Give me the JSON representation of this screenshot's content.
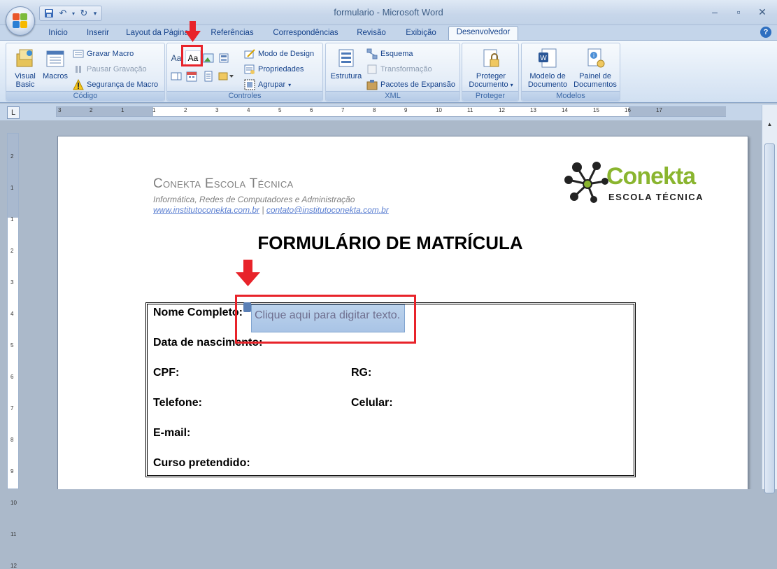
{
  "window": {
    "title": "formulario - Microsoft Word"
  },
  "qat": {
    "save_icon": "save-icon",
    "undo_icon": "undo-icon",
    "redo_icon": "redo-icon",
    "customize_icon": "customize-icon"
  },
  "tabs": [
    {
      "label": "Início"
    },
    {
      "label": "Inserir"
    },
    {
      "label": "Layout da Página"
    },
    {
      "label": "Referências"
    },
    {
      "label": "Correspondências"
    },
    {
      "label": "Revisão"
    },
    {
      "label": "Exibição"
    },
    {
      "label": "Desenvolvedor"
    }
  ],
  "ribbon": {
    "codigo": {
      "label": "Código",
      "visual_basic": "Visual\nBasic",
      "macros": "Macros",
      "gravar_macro": "Gravar Macro",
      "pausar_gravacao": "Pausar Gravação",
      "seguranca_macro": "Segurança de Macro"
    },
    "controles": {
      "label": "Controles",
      "modo_design": "Modo de Design",
      "propriedades": "Propriedades",
      "agrupar": "Agrupar",
      "aa_small": "Aa",
      "aa_boxed": "Aa"
    },
    "xml": {
      "label": "XML",
      "estrutura": "Estrutura",
      "esquema": "Esquema",
      "transformacao": "Transformação",
      "pacotes": "Pacotes de Expansão"
    },
    "proteger": {
      "label": "Proteger",
      "proteger_documento_1": "Proteger",
      "proteger_documento_2": "Documento"
    },
    "modelos": {
      "label": "Modelos",
      "modelo_1": "Modelo de",
      "modelo_2": "Documento",
      "painel_1": "Painel de",
      "painel_2": "Documentos"
    }
  },
  "ruler": {
    "h_numbers": [
      "3",
      "2",
      "1",
      "1",
      "2",
      "3",
      "4",
      "5",
      "6",
      "7",
      "8",
      "9",
      "10",
      "11",
      "12",
      "13",
      "14",
      "15",
      "16",
      "17"
    ],
    "v_numbers": [
      "2",
      "1",
      "1",
      "2",
      "3",
      "4",
      "5",
      "6",
      "7",
      "8",
      "9",
      "10",
      "11",
      "12"
    ]
  },
  "document": {
    "school_name": "Conekta Escola Técnica",
    "school_sub": "Informática, Redes de Computadores e Administração",
    "link_site": "www.institutoconekta.com.br",
    "link_sep": " | ",
    "link_email": "contato@institutoconekta.com.br",
    "logo_word": "Conekta",
    "logo_sub": "ESCOLA TÉCNICA",
    "title": "FORMULÁRIO DE MATRÍCULA",
    "fields": {
      "nome": "Nome Completo:",
      "nascimento": "Data de nascimento:",
      "cpf": "CPF:",
      "rg": "RG:",
      "telefone": "Telefone:",
      "celular": "Celular:",
      "email": "E-mail:",
      "curso": "Curso pretendido:"
    },
    "content_control_placeholder": "Clique aqui para digitar texto."
  },
  "colors": {
    "accent_red": "#e8232a",
    "logo_green": "#8ab52f",
    "link_blue": "#5b7fd1"
  }
}
